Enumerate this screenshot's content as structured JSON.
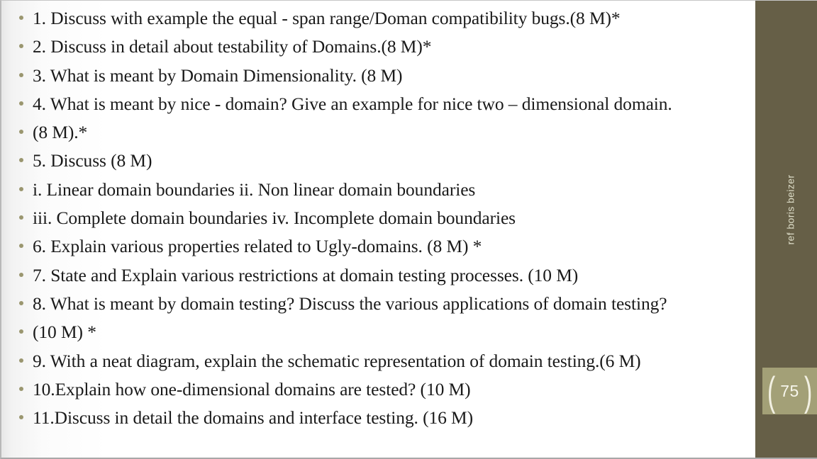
{
  "slide": {
    "bullets": [
      {
        "text": "1. Discuss with example the equal - span range/Doman compatibility bugs.(8 M)*"
      },
      {
        "text": "2. Discuss in detail about testability of Domains.(8 M)*"
      },
      {
        "text": "3. What is meant by Domain Dimensionality. (8 M)"
      },
      {
        "text": "4. What is meant by nice - domain? Give an example for nice two – dimensional domain."
      },
      {
        "text": "(8 M).*"
      },
      {
        "text": "5. Discuss (8 M)"
      },
      {
        "text": "i. Linear domain boundaries ii. Non linear domain boundaries"
      },
      {
        "text": "iii. Complete domain boundaries iv. Incomplete domain boundaries"
      },
      {
        "text": "6. Explain various properties related to Ugly-domains. (8 M) *"
      },
      {
        "text": "7. State and Explain various restrictions at domain testing processes. (10 M)"
      },
      {
        "text": "8. What is meant by domain testing? Discuss the various applications of domain testing?"
      },
      {
        "text": "(10 M) *"
      },
      {
        "text": "9. With a neat diagram, explain the schematic representation of domain testing.(6 M)"
      },
      {
        "text": "10.Explain how one-dimensional domains are tested? (10 M)"
      },
      {
        "text": "11.Discuss in detail the domains and interface testing. (16 M)"
      }
    ]
  },
  "sidebar": {
    "reference_label": "ref boris beizer",
    "page_number": "75",
    "paren_left": "(",
    "paren_right": ")",
    "colors": {
      "sidebar_bg": "#665F47",
      "badge_bg": "#A3A077",
      "badge_text": "#F7F6EC",
      "bullet_marker": "#9A966F"
    }
  }
}
